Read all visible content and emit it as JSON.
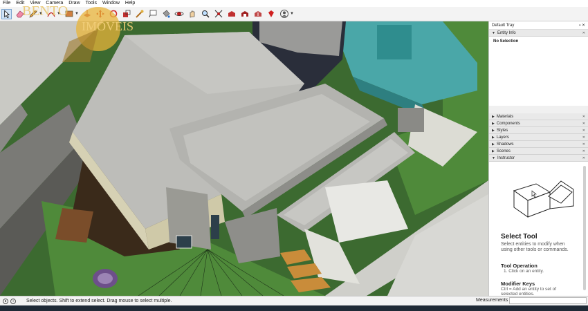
{
  "menu": [
    "File",
    "Edit",
    "View",
    "Camera",
    "Draw",
    "Tools",
    "Window",
    "Help"
  ],
  "toolbar": {
    "icons": [
      "select-icon",
      "eraser-icon",
      "pencil-icon",
      "arc-icon",
      "rectangle-icon",
      "push-pull-icon",
      "move-icon",
      "rotate-icon",
      "scale-icon",
      "tape-measure-icon",
      "text-icon",
      "paint-bucket-icon",
      "orbit-icon",
      "pan-icon",
      "zoom-icon",
      "zoom-extents-icon",
      "warehouse-icon",
      "extension-warehouse-icon",
      "share-icon",
      "ruby-icon",
      "account-icon"
    ]
  },
  "logo": {
    "line1": "BENTO",
    "line2": "IMÓVEIS"
  },
  "tray": {
    "title": "Default Tray",
    "entity_info": {
      "label": "Entity Info",
      "body": "No Selection"
    },
    "panels": [
      "Materials",
      "Components",
      "Styles",
      "Layers",
      "Shadows",
      "Scenes",
      "Instructor"
    ],
    "instructor": {
      "title": "Select Tool",
      "description": "Select entities to modify when using other tools or commands.",
      "operation_title": "Tool Operation",
      "operation_step": "1. Click on an entity.",
      "modifier_title": "Modifier Keys",
      "modifier_desc": "Ctrl = Add an entity to set of selected entities."
    }
  },
  "status": {
    "message": "Select objects. Shift to extend select. Drag mouse to select multiple.",
    "measurements_label": "Measurements",
    "measurements_value": ""
  },
  "colors": {
    "grass": "#4f8a3a",
    "roof": "#b9b9b6",
    "wall_beige": "#cfc9a8",
    "accent_teal": "#4aa7a8"
  }
}
